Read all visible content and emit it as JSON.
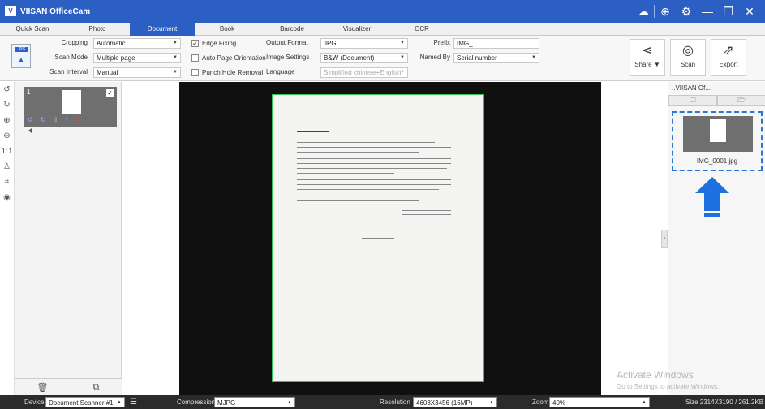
{
  "app": {
    "logo": "V",
    "title": "VIISAN OfficeCam"
  },
  "window": {
    "icons": [
      "cloud-icon",
      "globe-icon",
      "settings-icon",
      "minimize-icon",
      "restore-icon",
      "close-icon"
    ]
  },
  "tabs": [
    {
      "label": "Quick Scan"
    },
    {
      "label": "Photo"
    },
    {
      "label": "Document",
      "active": true
    },
    {
      "label": "Book"
    },
    {
      "label": "Barcode"
    },
    {
      "label": "Visualizer"
    },
    {
      "label": "OCR"
    }
  ],
  "ribbon": {
    "mode_icon_text": "JPG",
    "cropping_label": "Cropping",
    "cropping_value": "Automatic",
    "scan_mode_label": "Scan Mode",
    "scan_mode_value": "Multiple page",
    "scan_interval_label": "Scan Interval",
    "scan_interval_value": "Manual",
    "edge_fixing_label": "Edge Fixing",
    "edge_fixing_checked": true,
    "auto_page_label": "Auto Page Orientation",
    "auto_page_checked": false,
    "punch_hole_label": "Punch Hole Removal",
    "punch_hole_checked": false,
    "output_format_label": "Output Format",
    "output_format_value": "JPG",
    "image_settings_label": "Image Settings",
    "image_settings_value": "B&W (Document)",
    "language_label": "Language",
    "language_value": "Simplified chinese+English",
    "prefix_label": "Prefix",
    "prefix_value": "IMG_",
    "named_by_label": "Named By",
    "named_by_value": "Serial number",
    "share_label": "Share ▼",
    "scan_label": "Scan",
    "export_label": "Export"
  },
  "thumbnails": {
    "page_number": "1",
    "checked": true
  },
  "right_panel": {
    "folder": "..VIISAN Of...",
    "file_name": "IMG_0001.jpg"
  },
  "watermark": {
    "line1": "Activate Windows",
    "line2": "Go to Settings to activate Windows."
  },
  "status": {
    "device_label": "Device",
    "device_value": "Document Scanner #1",
    "compression_label": "Compression",
    "compression_value": "MJPG",
    "resolution_label": "Resolution",
    "resolution_value": "4608X3456 (16MP)",
    "zoom_label": "Zoom",
    "zoom_value": "40%",
    "size_text": "Size  2314X3190 / 261.2KB"
  }
}
